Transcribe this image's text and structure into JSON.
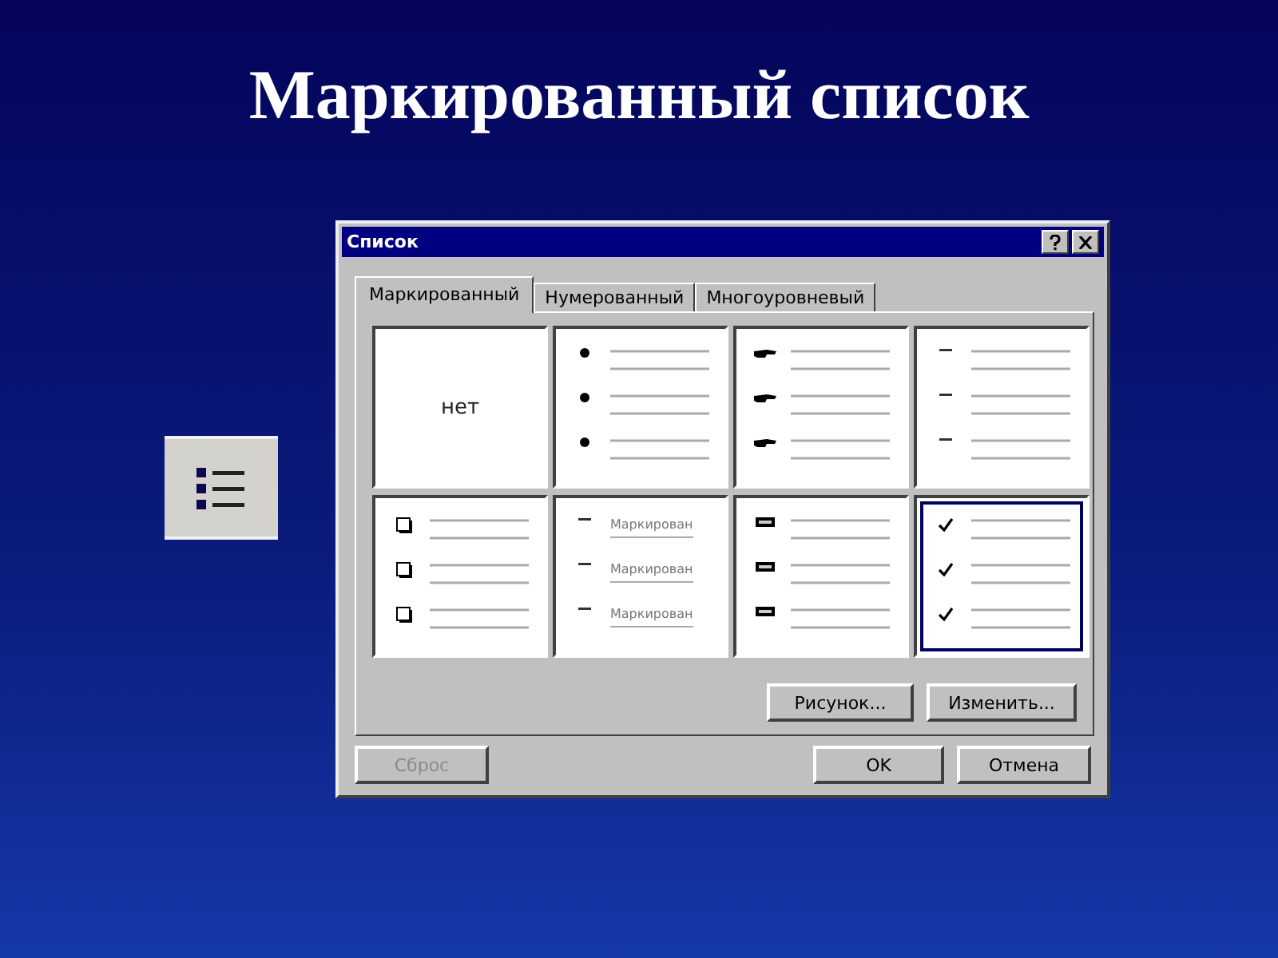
{
  "slide": {
    "title": "Маркированный список"
  },
  "dialog": {
    "title": "Список",
    "tabs": [
      {
        "label": "Маркированный",
        "selected": true
      },
      {
        "label": "Нумерованный",
        "selected": false
      },
      {
        "label": "Многоуровневый",
        "selected": false
      }
    ],
    "styles": [
      {
        "kind": "none",
        "label": "нет",
        "selected": false
      },
      {
        "kind": "dot",
        "selected": false
      },
      {
        "kind": "hand",
        "selected": false
      },
      {
        "kind": "dash",
        "selected": false
      },
      {
        "kind": "box",
        "selected": false
      },
      {
        "kind": "dash-text",
        "labels": [
          "Маркирован",
          "Маркирован",
          "Маркирован"
        ],
        "selected": false
      },
      {
        "kind": "bar",
        "selected": false
      },
      {
        "kind": "check",
        "selected": true
      }
    ],
    "panel_buttons": [
      {
        "label": "Рисунок...",
        "disabled": false
      },
      {
        "label": "Изменить...",
        "disabled": false
      }
    ],
    "footer_buttons": [
      {
        "label": "Сброс",
        "disabled": true
      },
      {
        "label": "OK",
        "disabled": false
      },
      {
        "label": "Отмена",
        "disabled": false
      }
    ]
  }
}
